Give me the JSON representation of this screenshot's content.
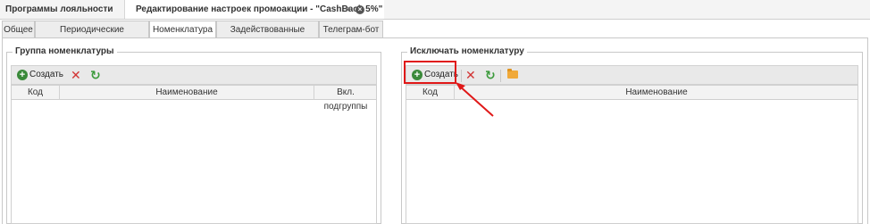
{
  "doc_tabs": {
    "loyalty_programs": "Программы лояльности",
    "edit_promo": "Редактирование настроек промоакции - \"CashBack 5%\"",
    "pin_glyph": "⇥",
    "close_glyph": "×"
  },
  "tabs": [
    "Общее",
    "Периодические зачисления",
    "Номенклатура",
    "Задействованные склады",
    "Телеграм-бот"
  ],
  "active_tab": "Номенклатура",
  "left_group": {
    "title": "Группа номенклатуры",
    "create_label": "Создать",
    "columns": [
      "Код",
      "Наименование",
      "Вкл. подгруппы"
    ]
  },
  "right_group": {
    "title": "Исключать номенклатуру",
    "create_label": "Создать",
    "columns": [
      "Код",
      "Наименование"
    ]
  },
  "icons": {
    "plus": "+",
    "delete": "✕",
    "refresh": "↻"
  },
  "colors": {
    "highlight": "#e01818",
    "plus_green": "#3a8a3a",
    "delete_red": "#d23434",
    "folder_orange": "#f0a93a"
  }
}
